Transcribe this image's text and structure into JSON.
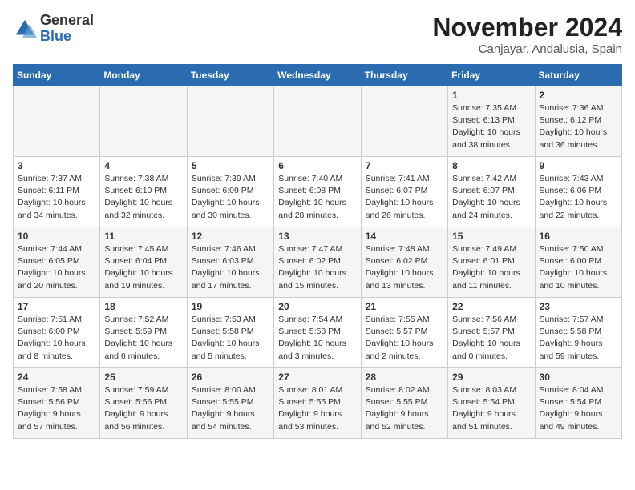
{
  "header": {
    "logo_general": "General",
    "logo_blue": "Blue",
    "month_title": "November 2024",
    "location": "Canjayar, Andalusia, Spain"
  },
  "days_of_week": [
    "Sunday",
    "Monday",
    "Tuesday",
    "Wednesday",
    "Thursday",
    "Friday",
    "Saturday"
  ],
  "weeks": [
    [
      {
        "day": "",
        "info": ""
      },
      {
        "day": "",
        "info": ""
      },
      {
        "day": "",
        "info": ""
      },
      {
        "day": "",
        "info": ""
      },
      {
        "day": "",
        "info": ""
      },
      {
        "day": "1",
        "info": "Sunrise: 7:35 AM\nSunset: 6:13 PM\nDaylight: 10 hours and 38 minutes."
      },
      {
        "day": "2",
        "info": "Sunrise: 7:36 AM\nSunset: 6:12 PM\nDaylight: 10 hours and 36 minutes."
      }
    ],
    [
      {
        "day": "3",
        "info": "Sunrise: 7:37 AM\nSunset: 6:11 PM\nDaylight: 10 hours and 34 minutes."
      },
      {
        "day": "4",
        "info": "Sunrise: 7:38 AM\nSunset: 6:10 PM\nDaylight: 10 hours and 32 minutes."
      },
      {
        "day": "5",
        "info": "Sunrise: 7:39 AM\nSunset: 6:09 PM\nDaylight: 10 hours and 30 minutes."
      },
      {
        "day": "6",
        "info": "Sunrise: 7:40 AM\nSunset: 6:08 PM\nDaylight: 10 hours and 28 minutes."
      },
      {
        "day": "7",
        "info": "Sunrise: 7:41 AM\nSunset: 6:07 PM\nDaylight: 10 hours and 26 minutes."
      },
      {
        "day": "8",
        "info": "Sunrise: 7:42 AM\nSunset: 6:07 PM\nDaylight: 10 hours and 24 minutes."
      },
      {
        "day": "9",
        "info": "Sunrise: 7:43 AM\nSunset: 6:06 PM\nDaylight: 10 hours and 22 minutes."
      }
    ],
    [
      {
        "day": "10",
        "info": "Sunrise: 7:44 AM\nSunset: 6:05 PM\nDaylight: 10 hours and 20 minutes."
      },
      {
        "day": "11",
        "info": "Sunrise: 7:45 AM\nSunset: 6:04 PM\nDaylight: 10 hours and 19 minutes."
      },
      {
        "day": "12",
        "info": "Sunrise: 7:46 AM\nSunset: 6:03 PM\nDaylight: 10 hours and 17 minutes."
      },
      {
        "day": "13",
        "info": "Sunrise: 7:47 AM\nSunset: 6:02 PM\nDaylight: 10 hours and 15 minutes."
      },
      {
        "day": "14",
        "info": "Sunrise: 7:48 AM\nSunset: 6:02 PM\nDaylight: 10 hours and 13 minutes."
      },
      {
        "day": "15",
        "info": "Sunrise: 7:49 AM\nSunset: 6:01 PM\nDaylight: 10 hours and 11 minutes."
      },
      {
        "day": "16",
        "info": "Sunrise: 7:50 AM\nSunset: 6:00 PM\nDaylight: 10 hours and 10 minutes."
      }
    ],
    [
      {
        "day": "17",
        "info": "Sunrise: 7:51 AM\nSunset: 6:00 PM\nDaylight: 10 hours and 8 minutes."
      },
      {
        "day": "18",
        "info": "Sunrise: 7:52 AM\nSunset: 5:59 PM\nDaylight: 10 hours and 6 minutes."
      },
      {
        "day": "19",
        "info": "Sunrise: 7:53 AM\nSunset: 5:58 PM\nDaylight: 10 hours and 5 minutes."
      },
      {
        "day": "20",
        "info": "Sunrise: 7:54 AM\nSunset: 5:58 PM\nDaylight: 10 hours and 3 minutes."
      },
      {
        "day": "21",
        "info": "Sunrise: 7:55 AM\nSunset: 5:57 PM\nDaylight: 10 hours and 2 minutes."
      },
      {
        "day": "22",
        "info": "Sunrise: 7:56 AM\nSunset: 5:57 PM\nDaylight: 10 hours and 0 minutes."
      },
      {
        "day": "23",
        "info": "Sunrise: 7:57 AM\nSunset: 5:58 PM\nDaylight: 9 hours and 59 minutes."
      }
    ],
    [
      {
        "day": "24",
        "info": "Sunrise: 7:58 AM\nSunset: 5:56 PM\nDaylight: 9 hours and 57 minutes."
      },
      {
        "day": "25",
        "info": "Sunrise: 7:59 AM\nSunset: 5:56 PM\nDaylight: 9 hours and 56 minutes."
      },
      {
        "day": "26",
        "info": "Sunrise: 8:00 AM\nSunset: 5:55 PM\nDaylight: 9 hours and 54 minutes."
      },
      {
        "day": "27",
        "info": "Sunrise: 8:01 AM\nSunset: 5:55 PM\nDaylight: 9 hours and 53 minutes."
      },
      {
        "day": "28",
        "info": "Sunrise: 8:02 AM\nSunset: 5:55 PM\nDaylight: 9 hours and 52 minutes."
      },
      {
        "day": "29",
        "info": "Sunrise: 8:03 AM\nSunset: 5:54 PM\nDaylight: 9 hours and 51 minutes."
      },
      {
        "day": "30",
        "info": "Sunrise: 8:04 AM\nSunset: 5:54 PM\nDaylight: 9 hours and 49 minutes."
      }
    ]
  ]
}
